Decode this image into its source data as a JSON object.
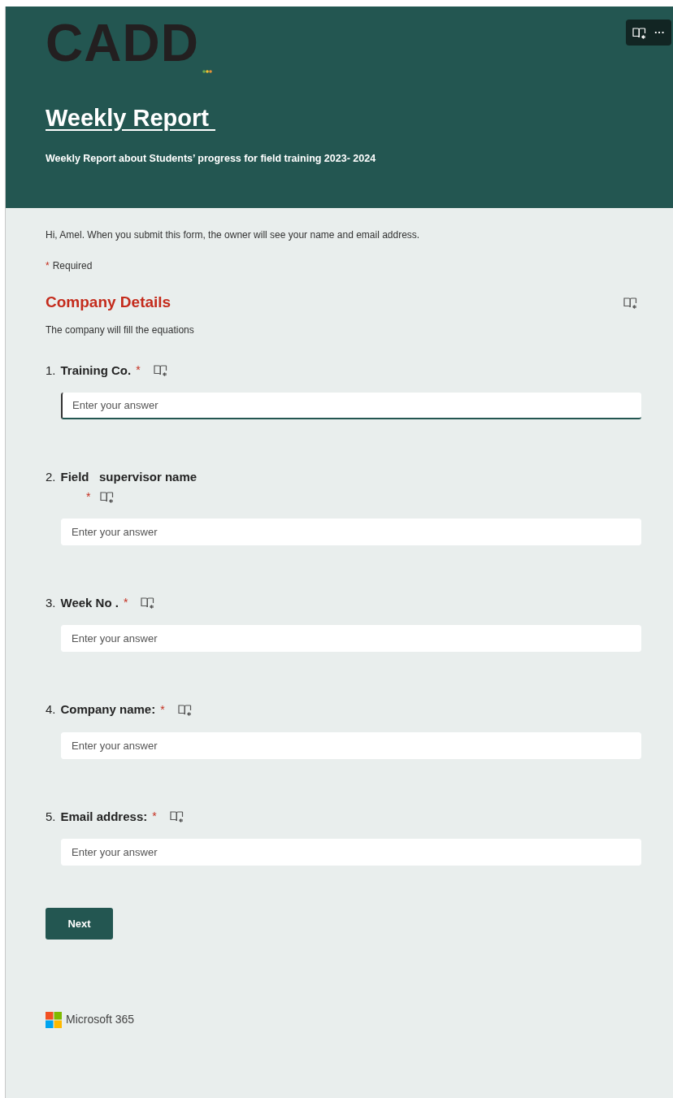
{
  "header": {
    "logo": "CADD",
    "title": "Weekly Report ",
    "subtitle": "Weekly Report about Students’ progress for field training 2023- 2024"
  },
  "toolbar": {
    "more": "···"
  },
  "notice": "Hi, Amel. When you submit this form, the owner will see your name and email address.",
  "required_note": {
    "mark": "*",
    "text": "Required"
  },
  "section": {
    "title": "Company Details",
    "description": "The company will fill the equations"
  },
  "questions": [
    {
      "number": "1.",
      "title": "Training Co.",
      "required": true,
      "asterisk_wraps": false,
      "placeholder": "Enter your answer",
      "focused": true
    },
    {
      "number": "2.",
      "title": "Field   supervisor name",
      "required": true,
      "asterisk_wraps": true,
      "placeholder": "Enter your answer",
      "focused": false
    },
    {
      "number": "3.",
      "title": "Week No .",
      "required": true,
      "asterisk_wraps": false,
      "placeholder": "Enter your answer",
      "focused": false
    },
    {
      "number": "4.",
      "title": "Company name:",
      "required": true,
      "asterisk_wraps": false,
      "placeholder": "Enter your answer",
      "focused": false
    },
    {
      "number": "5.",
      "title": "Email address:",
      "required": true,
      "asterisk_wraps": false,
      "placeholder": "Enter your answer",
      "focused": false
    }
  ],
  "next_button": "Next",
  "footer": {
    "brand": "Microsoft 365"
  }
}
